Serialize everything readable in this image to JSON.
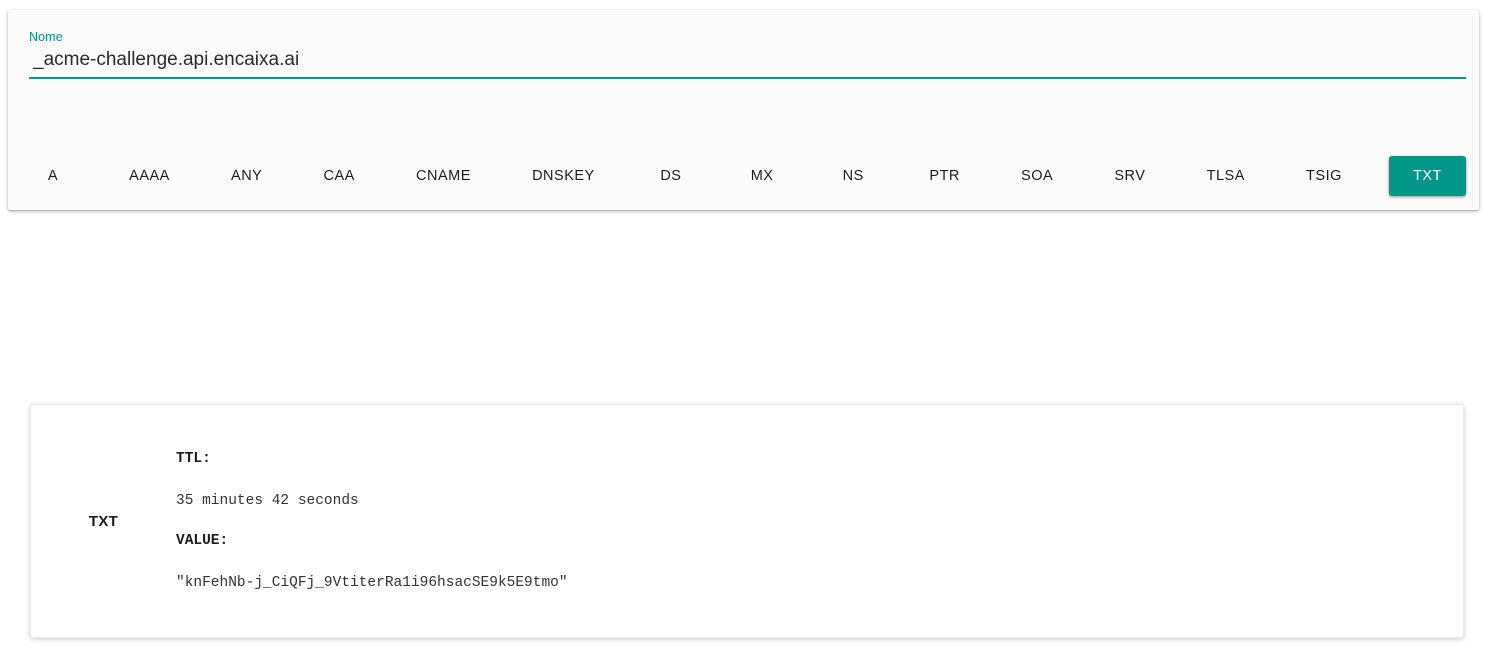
{
  "theme": {
    "accent": "#009688",
    "page_background": "#ffffff",
    "panel_background": "#fafafa",
    "card_background": "#ffffff",
    "text_color": "#1d1d1d"
  },
  "query_panel": {
    "name_field": {
      "label": "Nome",
      "value": "_acme-challenge.api.encaixa.ai",
      "placeholder": "Nome"
    },
    "record_types": [
      {
        "label": "A",
        "active": false
      },
      {
        "label": "AAAA",
        "active": false
      },
      {
        "label": "ANY",
        "active": false
      },
      {
        "label": "CAA",
        "active": false
      },
      {
        "label": "CNAME",
        "active": false
      },
      {
        "label": "DNSKEY",
        "active": false
      },
      {
        "label": "DS",
        "active": false
      },
      {
        "label": "MX",
        "active": false
      },
      {
        "label": "NS",
        "active": false
      },
      {
        "label": "PTR",
        "active": false
      },
      {
        "label": "SOA",
        "active": false
      },
      {
        "label": "SRV",
        "active": false
      },
      {
        "label": "TLSA",
        "active": false
      },
      {
        "label": "TSIG",
        "active": false
      },
      {
        "label": "TXT",
        "active": true
      }
    ]
  },
  "results": [
    {
      "type": "TXT",
      "ttl_label": "TTL:",
      "ttl_value": "35 minutes 42 seconds",
      "value_label": "VALUE:",
      "value": "\"knFehNb-j_CiQFj_9VtiterRa1i96hsacSE9k5E9tmo\""
    }
  ]
}
